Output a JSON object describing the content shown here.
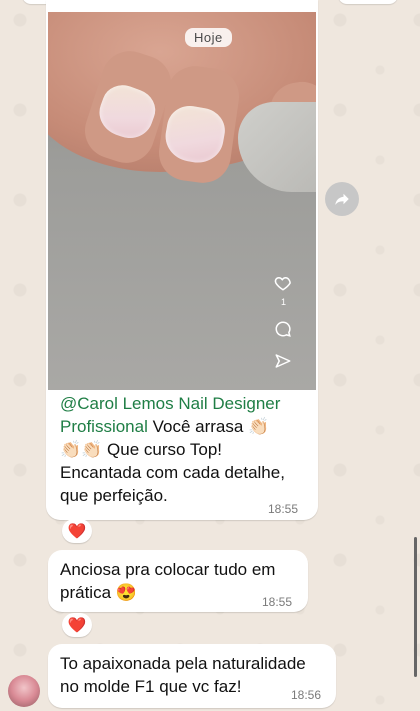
{
  "date_chip": "Hoje",
  "video": {
    "like_count": "1"
  },
  "caption": {
    "mention": "@Carol Lemos Nail Designer Profissional",
    "line1_rest": " Você arrasa 👏🏻",
    "line2": "👏🏻👏🏻 Que curso Top!",
    "line3": "Encantada com cada detalhe,",
    "line4": "que perfeição.",
    "time": "18:55",
    "reaction": "❤️"
  },
  "messages": [
    {
      "line1": "Anciosa pra colocar tudo em",
      "line2": "prática 😍",
      "time": "18:55",
      "reaction": "❤️"
    },
    {
      "line1": "To apaixonada pela naturalidade",
      "line2": "no molde F1 que vc faz!",
      "time": "18:56"
    }
  ]
}
